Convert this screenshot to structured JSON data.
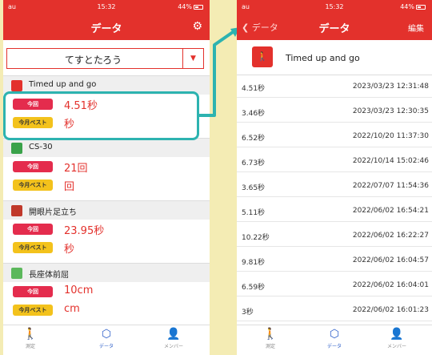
{
  "left": {
    "status": {
      "carrier": "au",
      "time": "15:32",
      "battery": "44%"
    },
    "nav_title": "データ",
    "user_name": "てすとたろう",
    "sections": [
      {
        "title": "Timed up and go",
        "icon_color": "#e3312c",
        "today_label": "今回",
        "today_value": "4.51秒",
        "best_label": "今月ベスト",
        "best_value": "秒"
      },
      {
        "title": "CS-30",
        "icon_color": "#3aa24a",
        "today_label": "今回",
        "today_value": "21回",
        "best_label": "今月ベスト",
        "best_value": "回"
      },
      {
        "title": "開眼片足立ち",
        "icon_color": "#c0392b",
        "today_label": "今回",
        "today_value": "23.95秒",
        "best_label": "今月ベスト",
        "best_value": "秒"
      },
      {
        "title": "長座体前屈",
        "icon_color": "#5cb85c",
        "today_label": "今回",
        "today_value": "10cm",
        "best_label": "今月ベスト",
        "best_value": "cm"
      }
    ],
    "tabs": [
      {
        "label": "測定",
        "icon": "walking-icon"
      },
      {
        "label": "データ",
        "icon": "data-icon"
      },
      {
        "label": "メンバー",
        "icon": "person-icon"
      }
    ]
  },
  "right": {
    "status": {
      "carrier": "au",
      "time": "15:32",
      "battery": "44%"
    },
    "back_label": "データ",
    "nav_title": "データ",
    "edit_label": "編集",
    "test_title": "Timed up and go",
    "records": [
      {
        "value": "4.51秒",
        "date": "2023/03/23 12:31:48"
      },
      {
        "value": "3.46秒",
        "date": "2023/03/23 12:30:35"
      },
      {
        "value": "6.52秒",
        "date": "2022/10/20 11:37:30"
      },
      {
        "value": "6.73秒",
        "date": "2022/10/14 15:02:46"
      },
      {
        "value": "3.65秒",
        "date": "2022/07/07 11:54:36"
      },
      {
        "value": "5.11秒",
        "date": "2022/06/02 16:54:21"
      },
      {
        "value": "10.22秒",
        "date": "2022/06/02 16:22:27"
      },
      {
        "value": "9.81秒",
        "date": "2022/06/02 16:04:57"
      },
      {
        "value": "6.59秒",
        "date": "2022/06/02 16:04:01"
      },
      {
        "value": "3秒",
        "date": "2022/06/02 16:01:23"
      }
    ],
    "tabs": [
      {
        "label": "測定",
        "icon": "walking-icon"
      },
      {
        "label": "データ",
        "icon": "data-icon"
      },
      {
        "label": "メンバー",
        "icon": "person-icon"
      }
    ]
  },
  "colors": {
    "accent": "#e3312c",
    "callout": "#2db3b0",
    "background": "#f4ecb4",
    "today_badge": "#e42c4d",
    "best_badge": "#f3c21c"
  }
}
